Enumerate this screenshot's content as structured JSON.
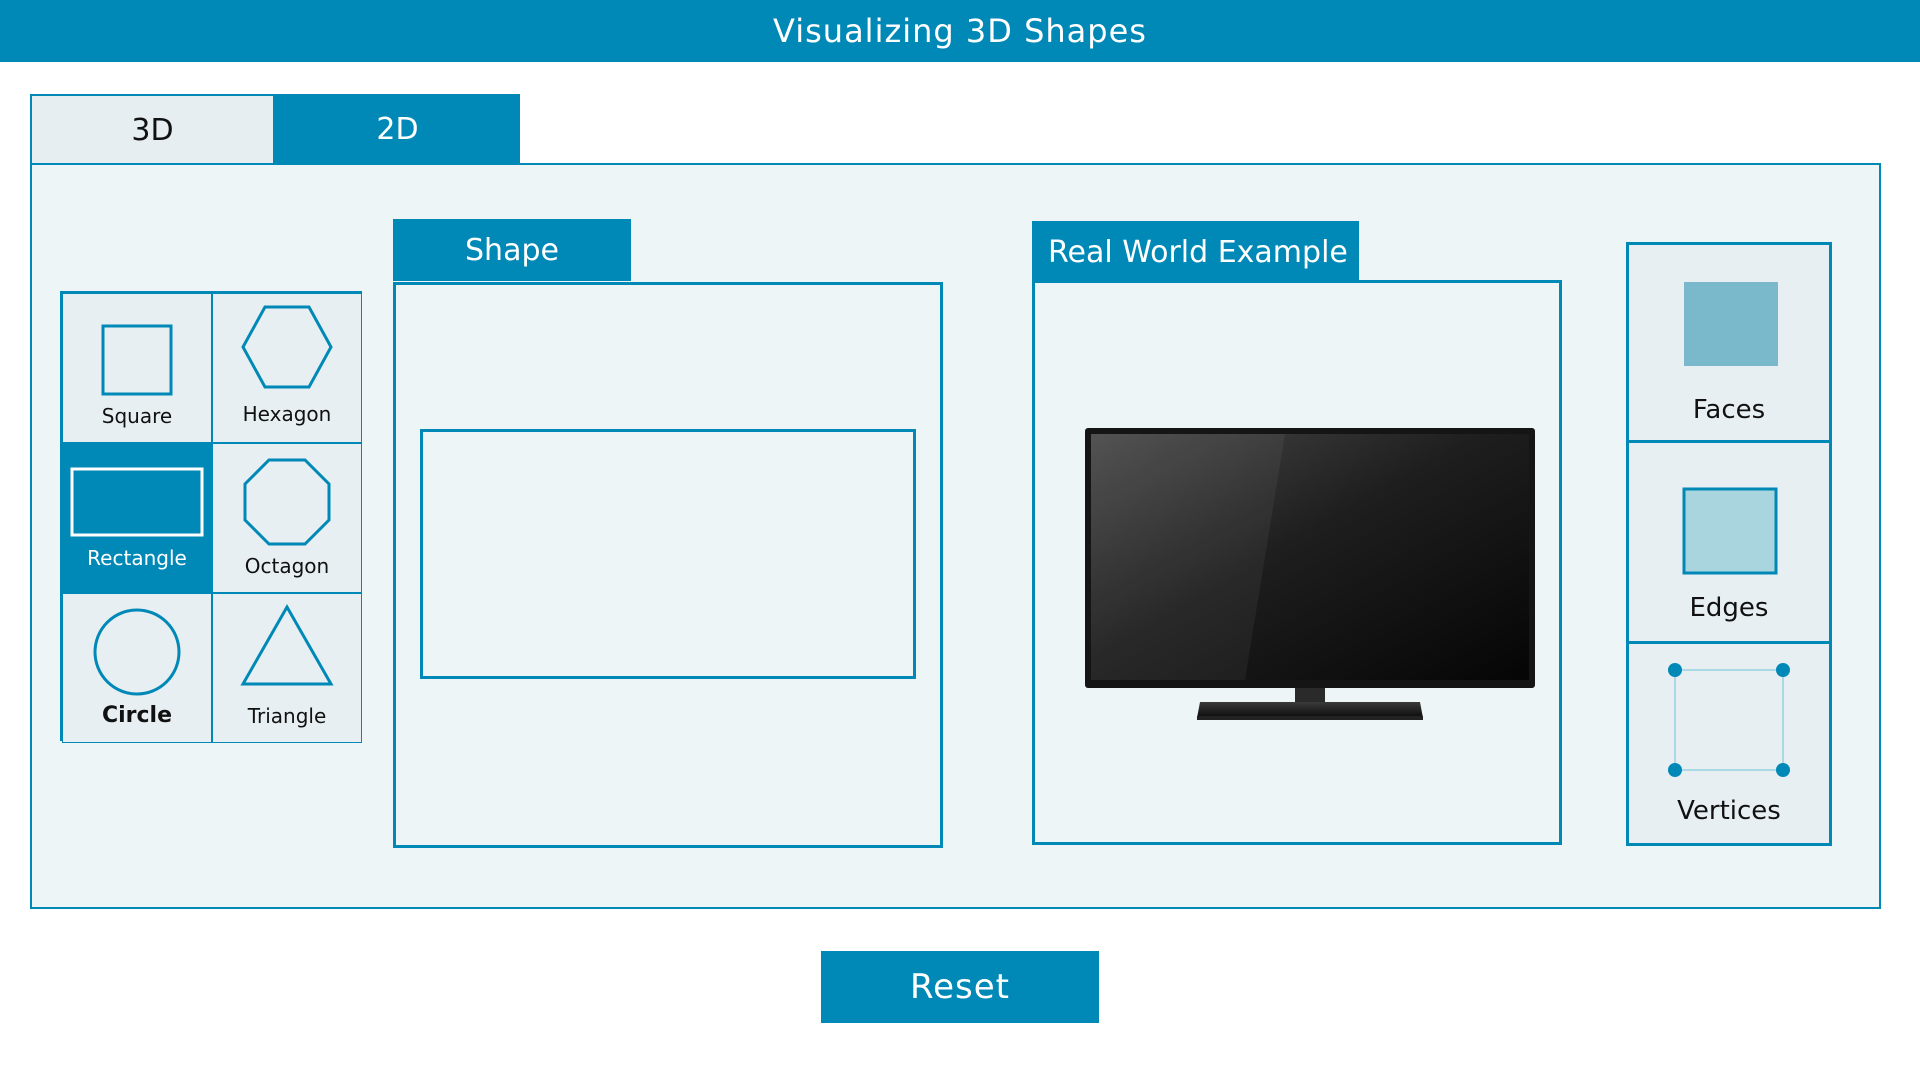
{
  "app": {
    "title": "Visualizing 3D Shapes"
  },
  "tabs": [
    {
      "label": "3D",
      "active": false
    },
    {
      "label": "2D",
      "active": true
    }
  ],
  "shapes": [
    {
      "label": "Square",
      "icon": "square-icon",
      "selected": false
    },
    {
      "label": "Hexagon",
      "icon": "hexagon-icon",
      "selected": false
    },
    {
      "label": "Rectangle",
      "icon": "rectangle-icon",
      "selected": true
    },
    {
      "label": "Octagon",
      "icon": "octagon-icon",
      "selected": false
    },
    {
      "label": "Circle",
      "icon": "circle-icon",
      "selected": false
    },
    {
      "label": "Triangle",
      "icon": "triangle-icon",
      "selected": false
    }
  ],
  "shape_panel": {
    "title": "Shape"
  },
  "example_panel": {
    "title": "Real World Example",
    "image": "television-image"
  },
  "properties": [
    {
      "label": "Faces",
      "icon": "faces-icon"
    },
    {
      "label": "Edges",
      "icon": "edges-icon"
    },
    {
      "label": "Vertices",
      "icon": "vertices-icon"
    }
  ],
  "reset": {
    "label": "Reset"
  },
  "colors": {
    "accent": "#0089b7",
    "panel_bg": "#eef5f6",
    "faces_fill": "#7ab8cb",
    "edges_fill": "#a9d6de"
  }
}
